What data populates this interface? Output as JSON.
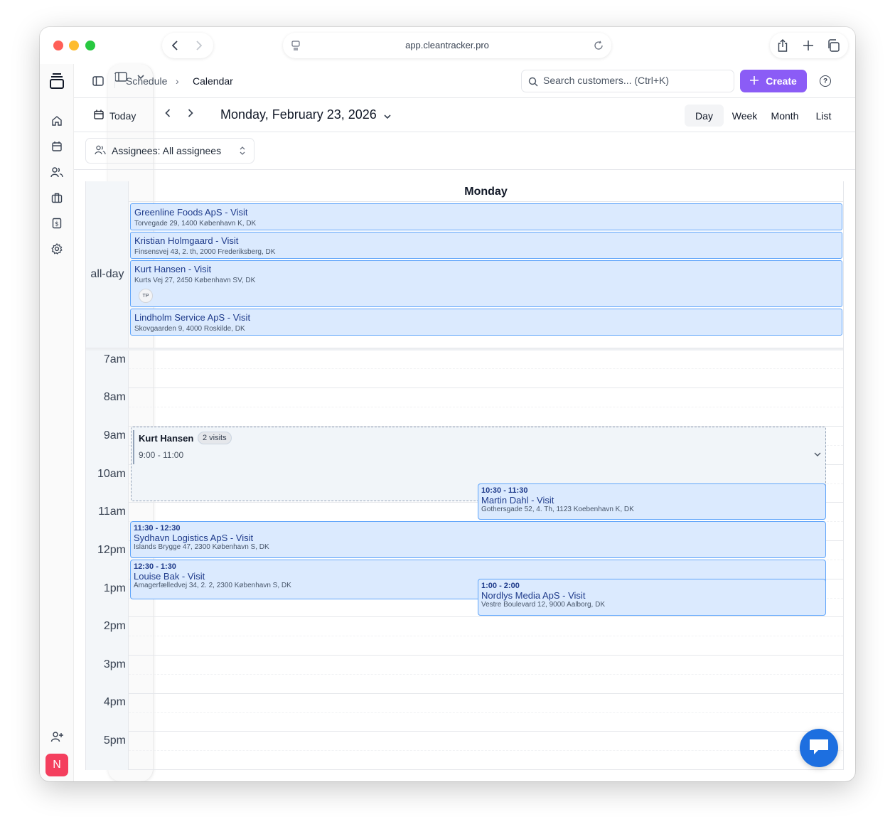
{
  "browser": {
    "url": "app.cleantracker.pro"
  },
  "breadcrumb": {
    "parent": "Schedule",
    "current": "Calendar"
  },
  "search": {
    "placeholder": "Search customers... (Ctrl+K)"
  },
  "toolbar": {
    "create_label": "Create",
    "help_label": "?",
    "today_label": "Today",
    "date_title": "Monday, February 23, 2026",
    "views": [
      "Day",
      "Week",
      "Month",
      "List"
    ],
    "active_view": "Day"
  },
  "filter": {
    "assignees_label": "Assignees: All assignees"
  },
  "calendar": {
    "day_header": "Monday",
    "allday_label": "all-day",
    "allday_events": [
      {
        "title": "Greenline Foods ApS - Visit",
        "address": "Torvegade 29, 1400 København K, DK"
      },
      {
        "title": "Kristian Holmgaard - Visit",
        "address": "Finsensvej 43, 2. th, 2000 Frederiksberg, DK"
      },
      {
        "title": "Kurt Hansen - Visit",
        "address": "Kurts Vej 27, 2450 København SV, DK",
        "assignee_initials": "TP"
      },
      {
        "title": "Lindholm Service ApS - Visit",
        "address": "Skovgaarden 9, 4000 Roskilde, DK"
      }
    ],
    "hours": [
      "7am",
      "8am",
      "9am",
      "10am",
      "11am",
      "12pm",
      "1pm",
      "2pm",
      "3pm",
      "4pm",
      "5pm"
    ],
    "group": {
      "name": "Kurt Hansen",
      "badge": "2 visits",
      "time": "9:00 - 11:00"
    },
    "events": [
      {
        "time": "10:30 - 11:30",
        "title": "Martin Dahl - Visit",
        "address": "Gothersgade 52, 4. Th, 1123 Koebenhavn K, DK"
      },
      {
        "time": "11:30 - 12:30",
        "title": "Sydhavn Logistics ApS - Visit",
        "address": "Islands Brygge 47, 2300 København S, DK"
      },
      {
        "time": "12:30 - 1:30",
        "title": "Louise Bak - Visit",
        "address": "Amagerfælledvej 34, 2. 2, 2300 København S, DK"
      },
      {
        "time": "1:00 - 2:00",
        "title": "Nordlys Media ApS - Visit",
        "address": "Vestre Boulevard 12, 9000 Aalborg, DK"
      }
    ]
  },
  "user": {
    "avatar_initial": "N"
  },
  "colors": {
    "accent": "#8b5cf6",
    "event_bg": "#dbeafe",
    "event_border": "#60a5fa",
    "chat": "#1d6fe0"
  }
}
